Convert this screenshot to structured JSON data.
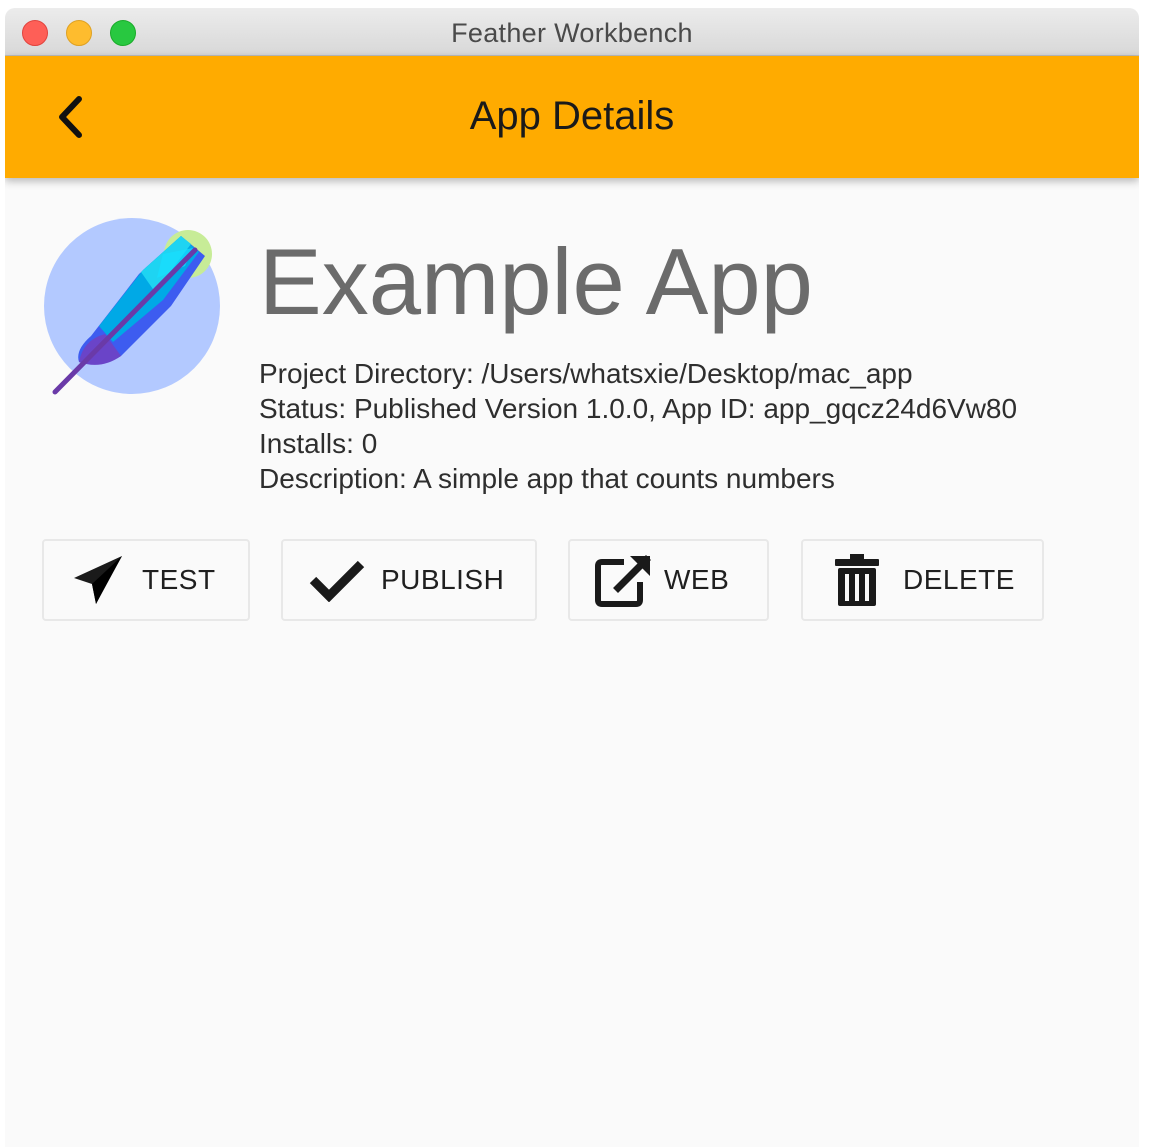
{
  "window": {
    "title": "Feather Workbench"
  },
  "appbar": {
    "title": "App Details",
    "back_icon": "chevron-left-icon",
    "color": "#ffab00"
  },
  "app": {
    "name": "Example App",
    "icon": "feather-logo",
    "details": {
      "project_directory": "Project Directory: /Users/whatsxie/Desktop/mac_app",
      "status": "Status: Published Version 1.0.0, App ID: app_gqcz24d6Vw80",
      "installs": "Installs: 0",
      "description": "Description: A simple app that counts numbers"
    }
  },
  "actions": [
    {
      "label": "TEST",
      "icon": "paper-plane-icon"
    },
    {
      "label": "PUBLISH",
      "icon": "checkmark-icon"
    },
    {
      "label": "WEB",
      "icon": "external-link-icon"
    },
    {
      "label": "DELETE",
      "icon": "trash-icon"
    }
  ]
}
